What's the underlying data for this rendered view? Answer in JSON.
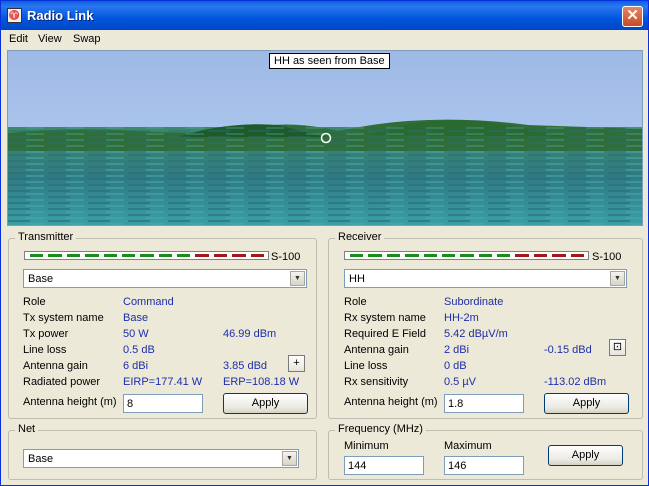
{
  "window": {
    "title": "Radio Link",
    "app_icon": "radio-link-app-icon",
    "close_icon": "close-icon"
  },
  "menu": [
    {
      "label": "Edit"
    },
    {
      "label": "View"
    },
    {
      "label": "Swap"
    }
  ],
  "view": {
    "label": "HH as seen from Base"
  },
  "transmitter": {
    "title": "Transmitter",
    "signal_label": "S-100",
    "site": "Base",
    "rows": [
      {
        "label": "Role",
        "value": "Command",
        "value2": ""
      },
      {
        "label": "Tx system name",
        "value": "Base",
        "value2": ""
      },
      {
        "label": "Tx power",
        "value": "50 W",
        "value2": "46.99 dBm"
      },
      {
        "label": "Line loss",
        "value": "0.5 dB",
        "value2": ""
      },
      {
        "label": "Antenna gain",
        "value": "6 dBi",
        "value2": "3.85 dBd"
      },
      {
        "label": "Radiated power",
        "value": "EIRP=177.41 W",
        "value2": "ERP=108.18 W"
      }
    ],
    "plus_label": "+",
    "antenna_height_label": "Antenna height (m)",
    "antenna_height": "8",
    "apply": "Apply"
  },
  "receiver": {
    "title": "Receiver",
    "signal_label": "S-100",
    "site": "HH",
    "rows": [
      {
        "label": "Role",
        "value": "Subordinate",
        "value2": ""
      },
      {
        "label": "Rx system name",
        "value": "HH-2m",
        "value2": ""
      },
      {
        "label": "Required E Field",
        "value": "5.42 dBµV/m",
        "value2": ""
      },
      {
        "label": "Antenna gain",
        "value": "2 dBi",
        "value2": "-0.15 dBd"
      },
      {
        "label": "Line loss",
        "value": "0 dB",
        "value2": ""
      },
      {
        "label": "Rx sensitivity",
        "value": "0.5 µV",
        "value2": "-113.02 dBm"
      }
    ],
    "antenna_height_label": "Antenna height (m)",
    "antenna_height": "1.8",
    "apply": "Apply"
  },
  "net": {
    "title": "Net",
    "value": "Base"
  },
  "frequency": {
    "title": "Frequency (MHz)",
    "min_label": "Minimum",
    "min": "144",
    "max_label": "Maximum",
    "max": "146",
    "apply": "Apply"
  },
  "signal_bar": {
    "segments": 13,
    "green_count": 9,
    "green": "#1a8c1a",
    "red": "#a01818"
  }
}
